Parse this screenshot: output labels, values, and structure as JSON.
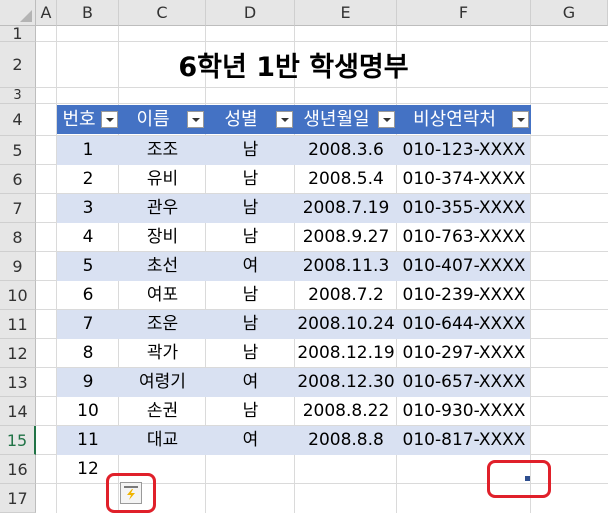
{
  "columns": [
    "A",
    "B",
    "C",
    "D",
    "E",
    "F",
    "G"
  ],
  "rows": [
    "1",
    "2",
    "3",
    "4",
    "5",
    "6",
    "7",
    "8",
    "9",
    "10",
    "11",
    "12",
    "13",
    "14",
    "15",
    "16",
    "17"
  ],
  "title": "6학년 1반 학생명부",
  "table": {
    "headers": [
      "번호",
      "이름",
      "성별",
      "생년월일",
      "비상연락처"
    ],
    "records": [
      [
        "1",
        "조조",
        "남",
        "2008.3.6",
        "010-123-XXXX"
      ],
      [
        "2",
        "유비",
        "남",
        "2008.5.4",
        "010-374-XXXX"
      ],
      [
        "3",
        "관우",
        "남",
        "2008.7.19",
        "010-355-XXXX"
      ],
      [
        "4",
        "장비",
        "남",
        "2008.9.27",
        "010-763-XXXX"
      ],
      [
        "5",
        "초선",
        "여",
        "2008.11.3",
        "010-407-XXXX"
      ],
      [
        "6",
        "여포",
        "남",
        "2008.7.2",
        "010-239-XXXX"
      ],
      [
        "7",
        "조운",
        "남",
        "2008.10.24",
        "010-644-XXXX"
      ],
      [
        "8",
        "곽가",
        "남",
        "2008.12.19",
        "010-297-XXXX"
      ],
      [
        "9",
        "여령기",
        "여",
        "2008.12.30",
        "010-657-XXXX"
      ],
      [
        "10",
        "손권",
        "남",
        "2008.8.22",
        "010-930-XXXX"
      ],
      [
        "11",
        "대교",
        "여",
        "2008.8.8",
        "010-817-XXXX"
      ]
    ],
    "next_value": "12"
  },
  "colors": {
    "header_fill": "#4472c4",
    "band_fill": "#d9e1f2",
    "highlight_red": "#e0202a"
  },
  "icons": {
    "quick_analysis": "lightning-icon",
    "table_resize": "resize-handle-icon"
  }
}
